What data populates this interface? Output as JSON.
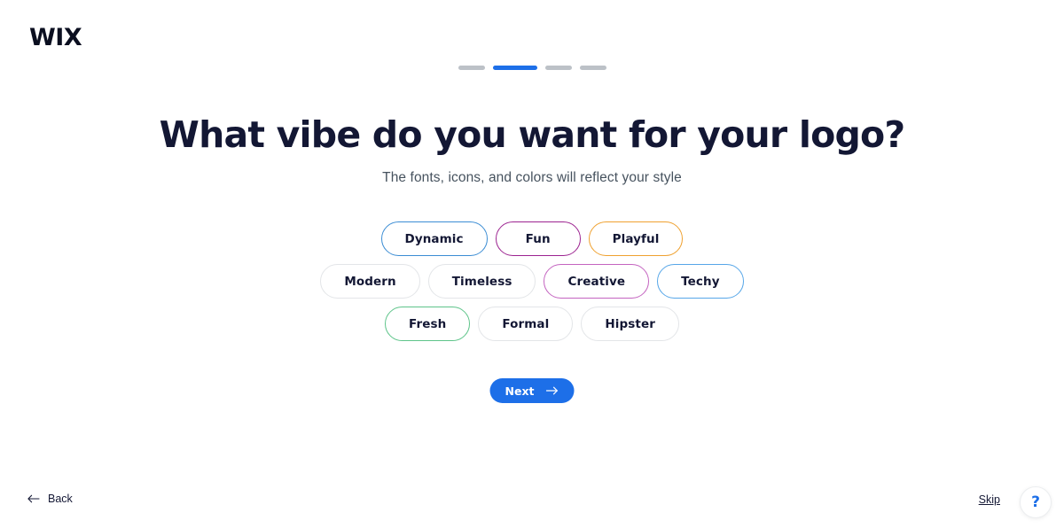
{
  "brand": {
    "name": "WIX"
  },
  "progress": {
    "total_steps": 4,
    "active_step": 2,
    "active_color": "#1d6fe8",
    "inactive_color": "#bcc1c7",
    "segments": [
      {
        "state": "inactive"
      },
      {
        "state": "active"
      },
      {
        "state": "inactive"
      },
      {
        "state": "inactive"
      }
    ]
  },
  "header": {
    "title": "What vibe do you want for your logo?",
    "subtitle": "The fonts, icons, and colors will reflect your style"
  },
  "vibes": {
    "rows": [
      [
        {
          "label": "Dynamic",
          "border_color": "#3c8dd4"
        },
        {
          "label": "Fun",
          "border_color": "#9c2390"
        },
        {
          "label": "Playful",
          "border_color": "#efa130"
        }
      ],
      [
        {
          "label": "Modern",
          "border_color": "#e3e5e8"
        },
        {
          "label": "Timeless",
          "border_color": "#e3e5e8"
        },
        {
          "label": "Creative",
          "border_color": "#c464c0"
        },
        {
          "label": "Techy",
          "border_color": "#56a6e8"
        }
      ],
      [
        {
          "label": "Fresh",
          "border_color": "#5ec48a"
        },
        {
          "label": "Formal",
          "border_color": "#e3e5e8"
        },
        {
          "label": "Hipster",
          "border_color": "#e3e5e8"
        }
      ]
    ]
  },
  "actions": {
    "next_label": "Next",
    "next_icon": "arrow-right-icon",
    "next_color": "#1d6fe8",
    "back_label": "Back",
    "back_icon": "arrow-left-icon",
    "skip_label": "Skip",
    "help_label": "?",
    "help_icon": "question-mark-icon"
  }
}
